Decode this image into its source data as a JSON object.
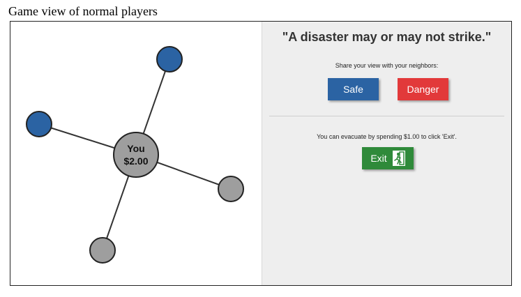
{
  "caption": "Game view of normal players",
  "graph": {
    "center": {
      "label": "You",
      "amount": "$2.00",
      "color": "#9e9e9e"
    },
    "neighbors": [
      {
        "id": "top",
        "status": "blue",
        "color": "#2b63a3"
      },
      {
        "id": "left",
        "status": "blue",
        "color": "#2b63a3"
      },
      {
        "id": "right",
        "status": "gray",
        "color": "#9e9e9e"
      },
      {
        "id": "bottom",
        "status": "gray",
        "color": "#9e9e9e"
      }
    ]
  },
  "panel": {
    "headline": "\"A disaster may or may not strike.\"",
    "share_text": "Share your view with your neighbors:",
    "safe_label": "Safe",
    "danger_label": "Danger",
    "evacuate_text": "You can evacuate by spending $1.00 to click 'Exit'.",
    "exit_label": "Exit",
    "exit_icon": "running-man-exit-icon"
  },
  "colors": {
    "safe": "#2b63a3",
    "danger": "#e2393a",
    "exit": "#2f8a3a",
    "panel_bg": "#eeeeee"
  }
}
